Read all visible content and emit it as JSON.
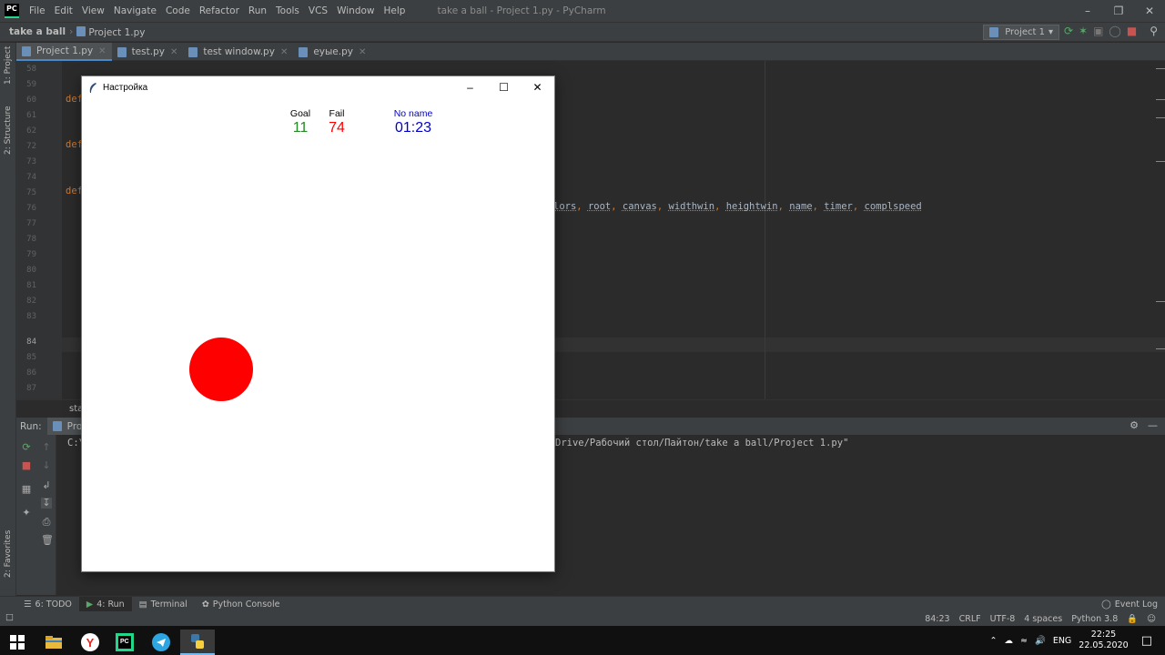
{
  "ide": {
    "logo": "PC",
    "menu": [
      "File",
      "Edit",
      "View",
      "Navigate",
      "Code",
      "Refactor",
      "Run",
      "Tools",
      "VCS",
      "Window",
      "Help"
    ],
    "window_title": "take a ball - Project 1.py - PyCharm",
    "breadcrumbs": [
      "take a ball",
      "Project 1.py"
    ],
    "run_config": "Project 1",
    "tabs": [
      {
        "label": "Project 1.py",
        "active": true
      },
      {
        "label": "test.py",
        "active": false
      },
      {
        "label": "test window.py",
        "active": false
      },
      {
        "label": "еуые.py",
        "active": false
      }
    ],
    "left_tools": [
      "1: Project",
      "2: Structure",
      "2: Favorites"
    ],
    "line_numbers": [
      "58",
      "59",
      "60",
      "61",
      "62",
      "72",
      "73",
      "74",
      "75",
      "76",
      "77",
      "78",
      "79",
      "80",
      "81",
      "82",
      "83",
      "84",
      "85",
      "86",
      "87"
    ],
    "current_line": "84",
    "def_keyword": "def",
    "param_fragment": "lors",
    "params": [
      "root",
      "canvas",
      "widthwin",
      "heightwin",
      "name",
      "timer",
      "complspeed"
    ],
    "editor_status": "sta"
  },
  "run_panel": {
    "label": "Run:",
    "tab_label": "Proj",
    "console_prefix": "C:\\",
    "console_path": "Drive/Рабочий стол/Пайтон/take a ball/Project 1.py\""
  },
  "bottom_tools": [
    {
      "label": "6: TODO"
    },
    {
      "label": "4: Run"
    },
    {
      "label": "Terminal"
    },
    {
      "label": "Python Console"
    }
  ],
  "event_log": "Event Log",
  "status_bar": {
    "position": "84:23",
    "line_sep": "CRLF",
    "encoding": "UTF-8",
    "indent": "4 spaces",
    "interpreter": "Python 3.8"
  },
  "taskbar": {
    "lang": "ENG",
    "time": "22:25",
    "date": "22.05.2020"
  },
  "game": {
    "title": "Настройка",
    "goal_label": "Goal",
    "goal_value": "11",
    "fail_label": "Fail",
    "fail_value": "74",
    "player_name": "No name",
    "timer": "01:23",
    "colors": {
      "goal": "#228b22",
      "fail": "#ff0000",
      "player": "#0000cd",
      "ball": "#ff0000"
    }
  }
}
